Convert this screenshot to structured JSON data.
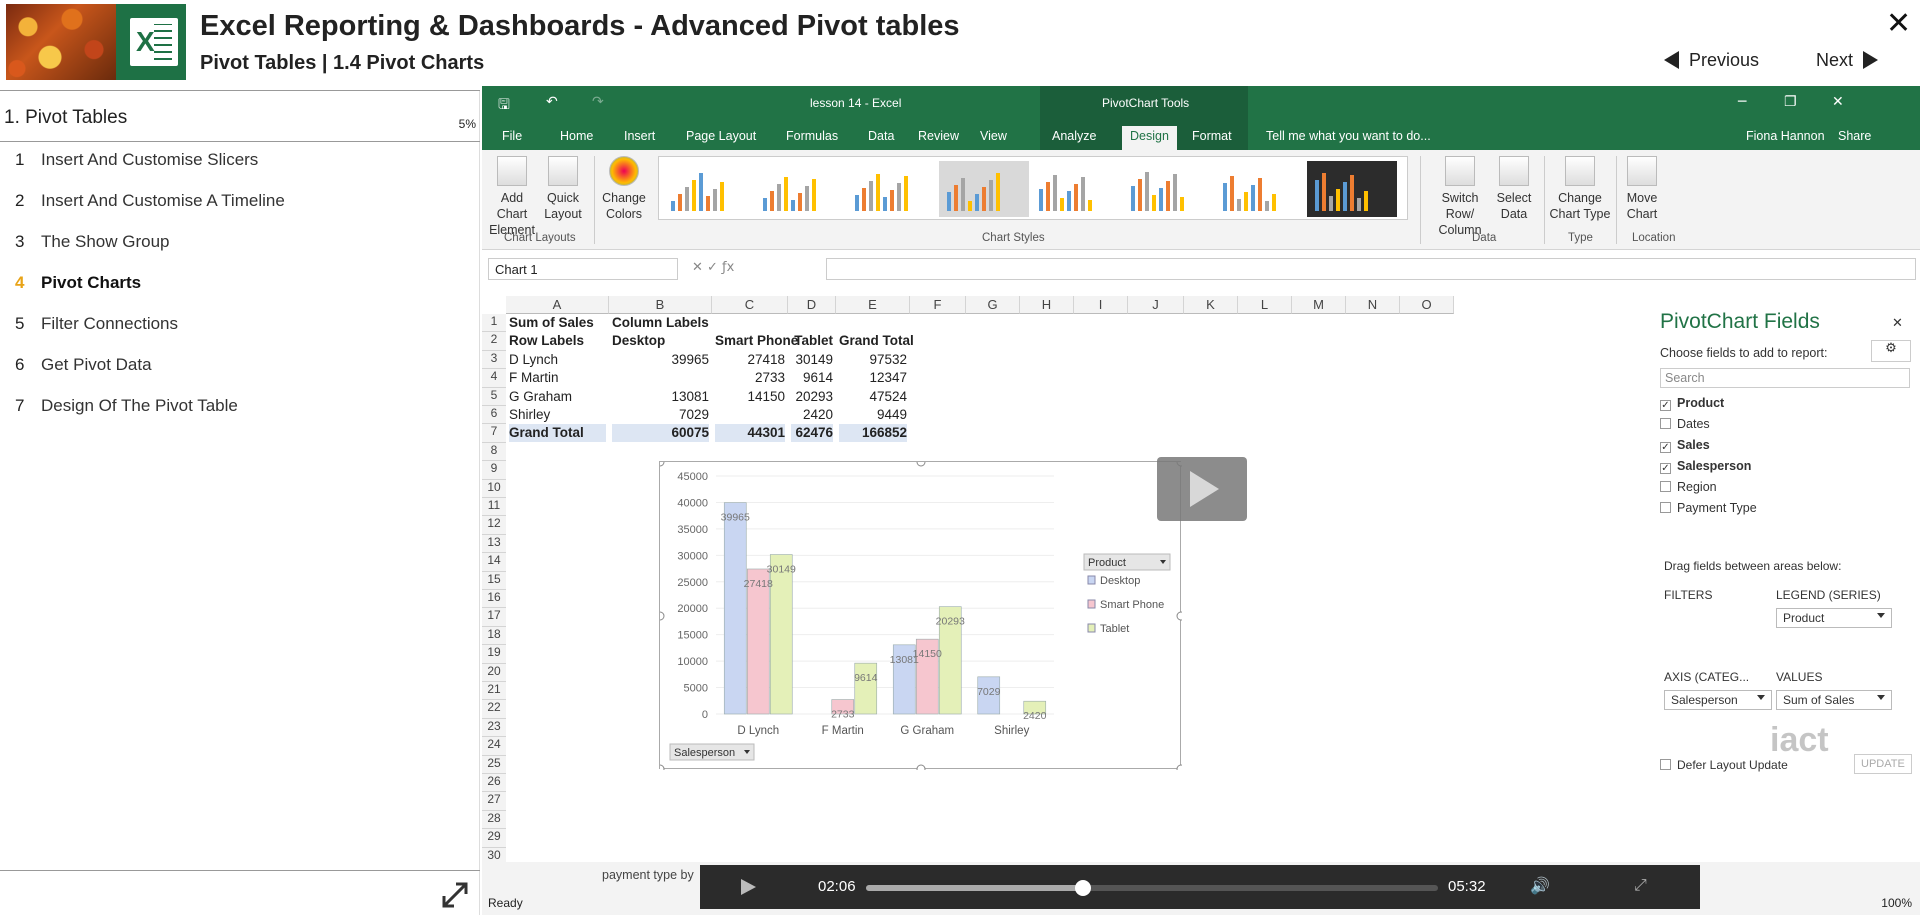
{
  "header": {
    "title": "Excel Reporting & Dashboards - Advanced Pivot tables",
    "subtitle": "Pivot Tables | 1.4 Pivot Charts",
    "prev_label": "Previous",
    "next_label": "Next"
  },
  "sidebar": {
    "section_title": "1. Pivot Tables",
    "progress": "5%",
    "lessons": [
      {
        "num": "1",
        "label": "Insert And Customise Slicers"
      },
      {
        "num": "2",
        "label": "Insert And Customise A Timeline"
      },
      {
        "num": "3",
        "label": "The Show Group"
      },
      {
        "num": "4",
        "label": "Pivot Charts"
      },
      {
        "num": "5",
        "label": "Filter Connections"
      },
      {
        "num": "6",
        "label": "Get Pivot Data"
      },
      {
        "num": "7",
        "label": "Design Of The Pivot Table"
      }
    ],
    "active_index": 3
  },
  "excel": {
    "doc_title": "lesson 14 - Excel",
    "context_title": "PivotChart Tools",
    "user": "Fiona Hannon",
    "share": "Share",
    "tabs": [
      "File",
      "Home",
      "Insert",
      "Page Layout",
      "Formulas",
      "Data",
      "Review",
      "View",
      "Analyze",
      "Design",
      "Format"
    ],
    "selected_tab": "Design",
    "tell_me": "Tell me what you want to do...",
    "ribbon": {
      "add_chart_element": [
        "Add Chart",
        "Element"
      ],
      "quick_layout": [
        "Quick",
        "Layout"
      ],
      "change_colors": [
        "Change",
        "Colors"
      ],
      "switch_row_col": [
        "Switch Row/",
        "Column"
      ],
      "select_data": [
        "Select",
        "Data"
      ],
      "change_chart_type": [
        "Change",
        "Chart Type"
      ],
      "move_chart": [
        "Move",
        "Chart"
      ],
      "groups": {
        "layouts": "Chart Layouts",
        "styles": "Chart Styles",
        "data": "Data",
        "type": "Type",
        "location": "Location"
      }
    },
    "name_box": "Chart 1",
    "columns": [
      "A",
      "B",
      "C",
      "D",
      "E",
      "F",
      "G",
      "H",
      "I",
      "J",
      "K",
      "L",
      "M",
      "N",
      "O"
    ],
    "rows": [
      "1",
      "2",
      "3",
      "4",
      "5",
      "6",
      "7",
      "8",
      "9",
      "10",
      "11",
      "12",
      "13",
      "14",
      "15",
      "16",
      "17",
      "18",
      "19",
      "20",
      "21",
      "22",
      "23",
      "24",
      "25",
      "26",
      "27",
      "28",
      "29",
      "30"
    ],
    "pivot": {
      "r1": [
        "Sum of Sales",
        "Column Labels"
      ],
      "r2": [
        "Row Labels",
        "Desktop",
        "Smart Phone",
        "Tablet",
        "Grand Total"
      ],
      "body": [
        [
          "D Lynch",
          "39965",
          "27418",
          "30149",
          "97532"
        ],
        [
          "F Martin",
          "",
          "2733",
          "9614",
          "12347"
        ],
        [
          "G Graham",
          "13081",
          "14150",
          "20293",
          "47524"
        ],
        [
          "Shirley",
          "7029",
          "",
          "2420",
          "9449"
        ],
        [
          "Grand Total",
          "60075",
          "44301",
          "62476",
          "166852"
        ]
      ]
    },
    "sheet_tab": "payment type by",
    "status": "Ready",
    "zoom": "100%"
  },
  "chart_data": {
    "type": "bar",
    "categories": [
      "D Lynch",
      "F Martin",
      "G Graham",
      "Shirley"
    ],
    "series": [
      {
        "name": "Desktop",
        "values": [
          39965,
          null,
          13081,
          7029
        ],
        "color": "#c9d6f2"
      },
      {
        "name": "Smart Phone",
        "values": [
          27418,
          2733,
          14150,
          null
        ],
        "color": "#f6c6cf"
      },
      {
        "name": "Tablet",
        "values": [
          30149,
          9614,
          20293,
          2420
        ],
        "color": "#e4f0b8"
      }
    ],
    "data_labels": [
      "39965",
      "27418",
      "30149",
      "2733",
      "9614",
      "13081",
      "14150",
      "20293",
      "7029",
      "2420"
    ],
    "ylim": [
      0,
      45000
    ],
    "yticks": [
      "45000",
      "40000",
      "35000",
      "30000",
      "25000",
      "20000",
      "15000",
      "10000",
      "5000",
      "0"
    ],
    "legend_title": "Product",
    "axis_button": "Salesperson",
    "legend_position": "right"
  },
  "pivot_panel": {
    "title": "PivotChart Fields",
    "choose": "Choose fields to add to report:",
    "search_placeholder": "Search",
    "fields": [
      {
        "name": "Product",
        "checked": true
      },
      {
        "name": "Dates",
        "checked": false
      },
      {
        "name": "Sales",
        "checked": true
      },
      {
        "name": "Salesperson",
        "checked": true
      },
      {
        "name": "Region",
        "checked": false
      },
      {
        "name": "Payment Type",
        "checked": false
      }
    ],
    "drag_hint": "Drag fields between areas below:",
    "filters": "FILTERS",
    "legend": "LEGEND (SERIES)",
    "legend_value": "Product",
    "axis": "AXIS (CATEG...",
    "axis_value": "Salesperson",
    "values": "VALUES",
    "values_value": "Sum of Sales",
    "defer": "Defer Layout Update",
    "update": "UPDATE"
  },
  "player": {
    "current_time": "02:06",
    "duration": "05:32",
    "progress": 0.38
  },
  "watermark": "iact"
}
